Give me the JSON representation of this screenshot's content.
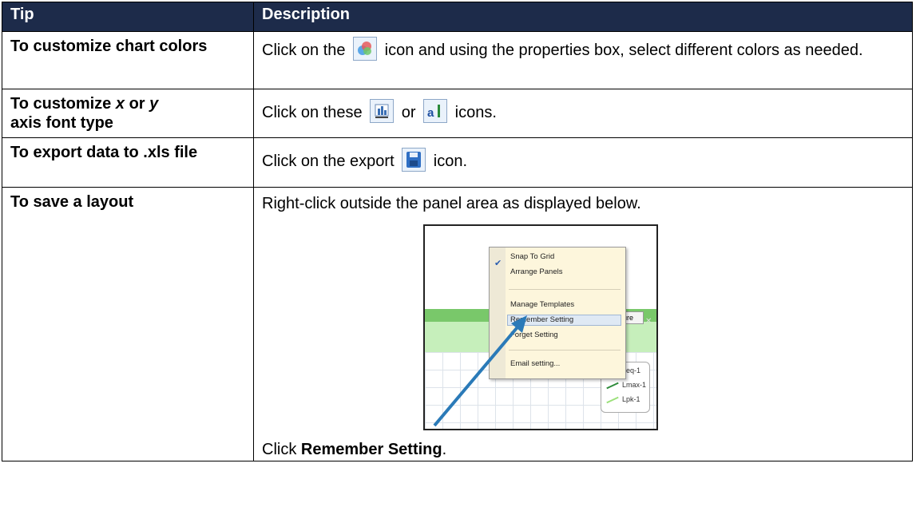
{
  "table": {
    "header_tip": "Tip",
    "header_desc": "Description"
  },
  "rows": [
    {
      "tip": "To customize chart colors",
      "desc_before": "Click on the",
      "desc_after": "icon and using the properties box, select different colors as needed."
    },
    {
      "tip_part1": "To customize",
      "tip_x": "x",
      "tip_or": "or",
      "tip_y": "y",
      "tip_part2": "axis font type",
      "desc_before": "Click on these",
      "desc_or": "or",
      "desc_after": "icons."
    },
    {
      "tip": "To export data to .xls file",
      "desc_before": "Click on the export",
      "desc_after": "icon."
    },
    {
      "tip": "To save a layout",
      "desc_intro": "Right-click outside the panel area as displayed below.",
      "desc_click": "Click",
      "desc_bold": "Remember Setting",
      "desc_period": "."
    }
  ],
  "context_menu": {
    "items": [
      "Snap To Grid",
      "Arrange Panels",
      "Manage Templates",
      "Remember Setting",
      "Forget Setting",
      "Email setting..."
    ],
    "checked_item": "Snap To Grid",
    "highlighted_item": "Remember Setting"
  },
  "tab_label": "gure",
  "legend": [
    {
      "label": "Leq-1",
      "color": "#ffffff"
    },
    {
      "label": "Lmax-1",
      "color": "#2e8b3a"
    },
    {
      "label": "Lpk-1",
      "color": "#9be07a"
    }
  ],
  "icons": [
    "color-palette-icon",
    "x-axis-font-icon",
    "y-axis-font-icon",
    "save-export-icon",
    "checkmark-icon",
    "close-icon"
  ],
  "colors": {
    "header_bg": "#1d2b4a",
    "arrow": "#2a7ab8"
  }
}
